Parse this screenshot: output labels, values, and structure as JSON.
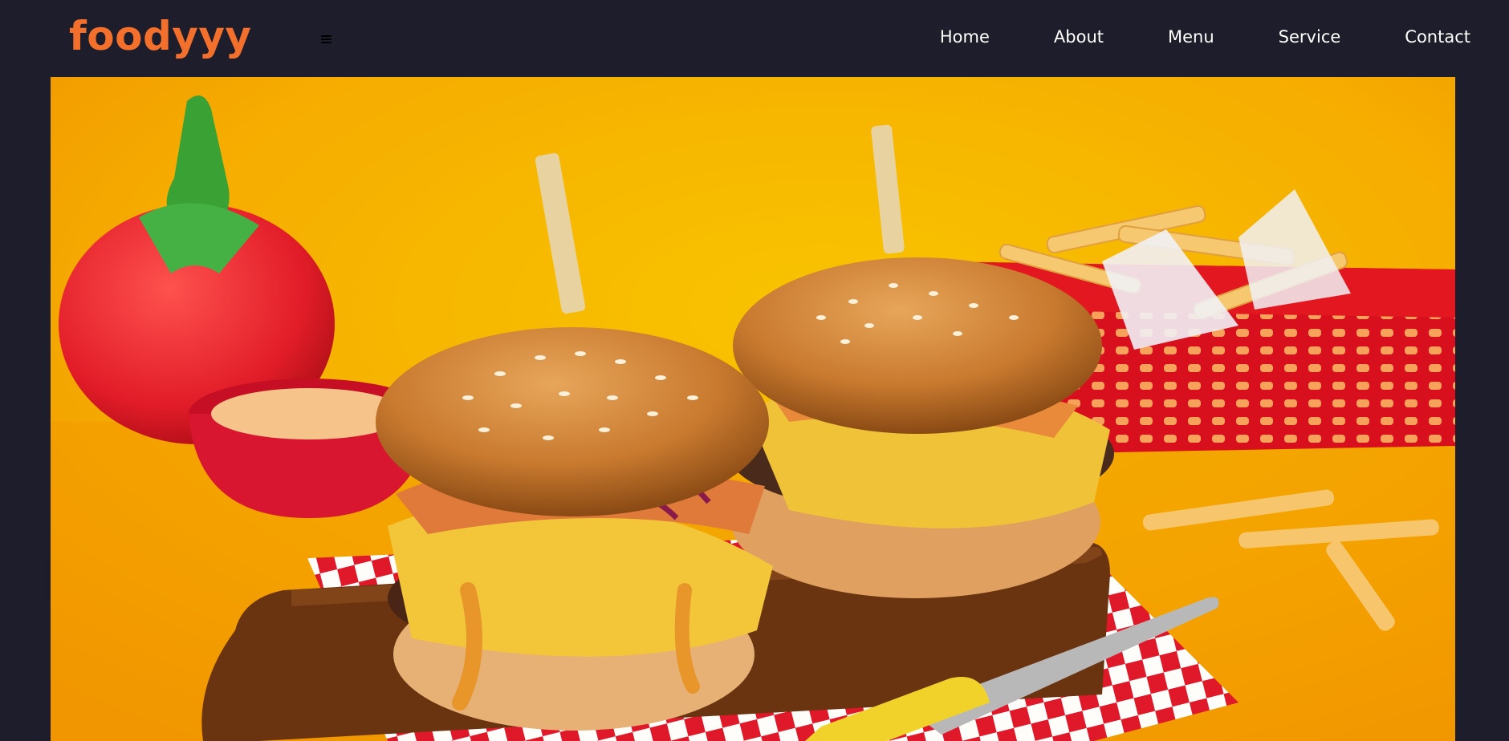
{
  "brand": {
    "name": "foodyyy",
    "color": "#f26f2c"
  },
  "menu_toggle": {
    "icon": "hamburger-icon"
  },
  "nav": {
    "items": [
      {
        "label": "Home"
      },
      {
        "label": "About"
      },
      {
        "label": "Menu"
      },
      {
        "label": "Service"
      },
      {
        "label": "Contact"
      }
    ]
  },
  "hero": {
    "image": "burgers-photo",
    "background": "#f6b800"
  },
  "colors": {
    "page_background": "#1e1d2b",
    "nav_text": "#ffffff",
    "accent": "#f26f2c"
  }
}
